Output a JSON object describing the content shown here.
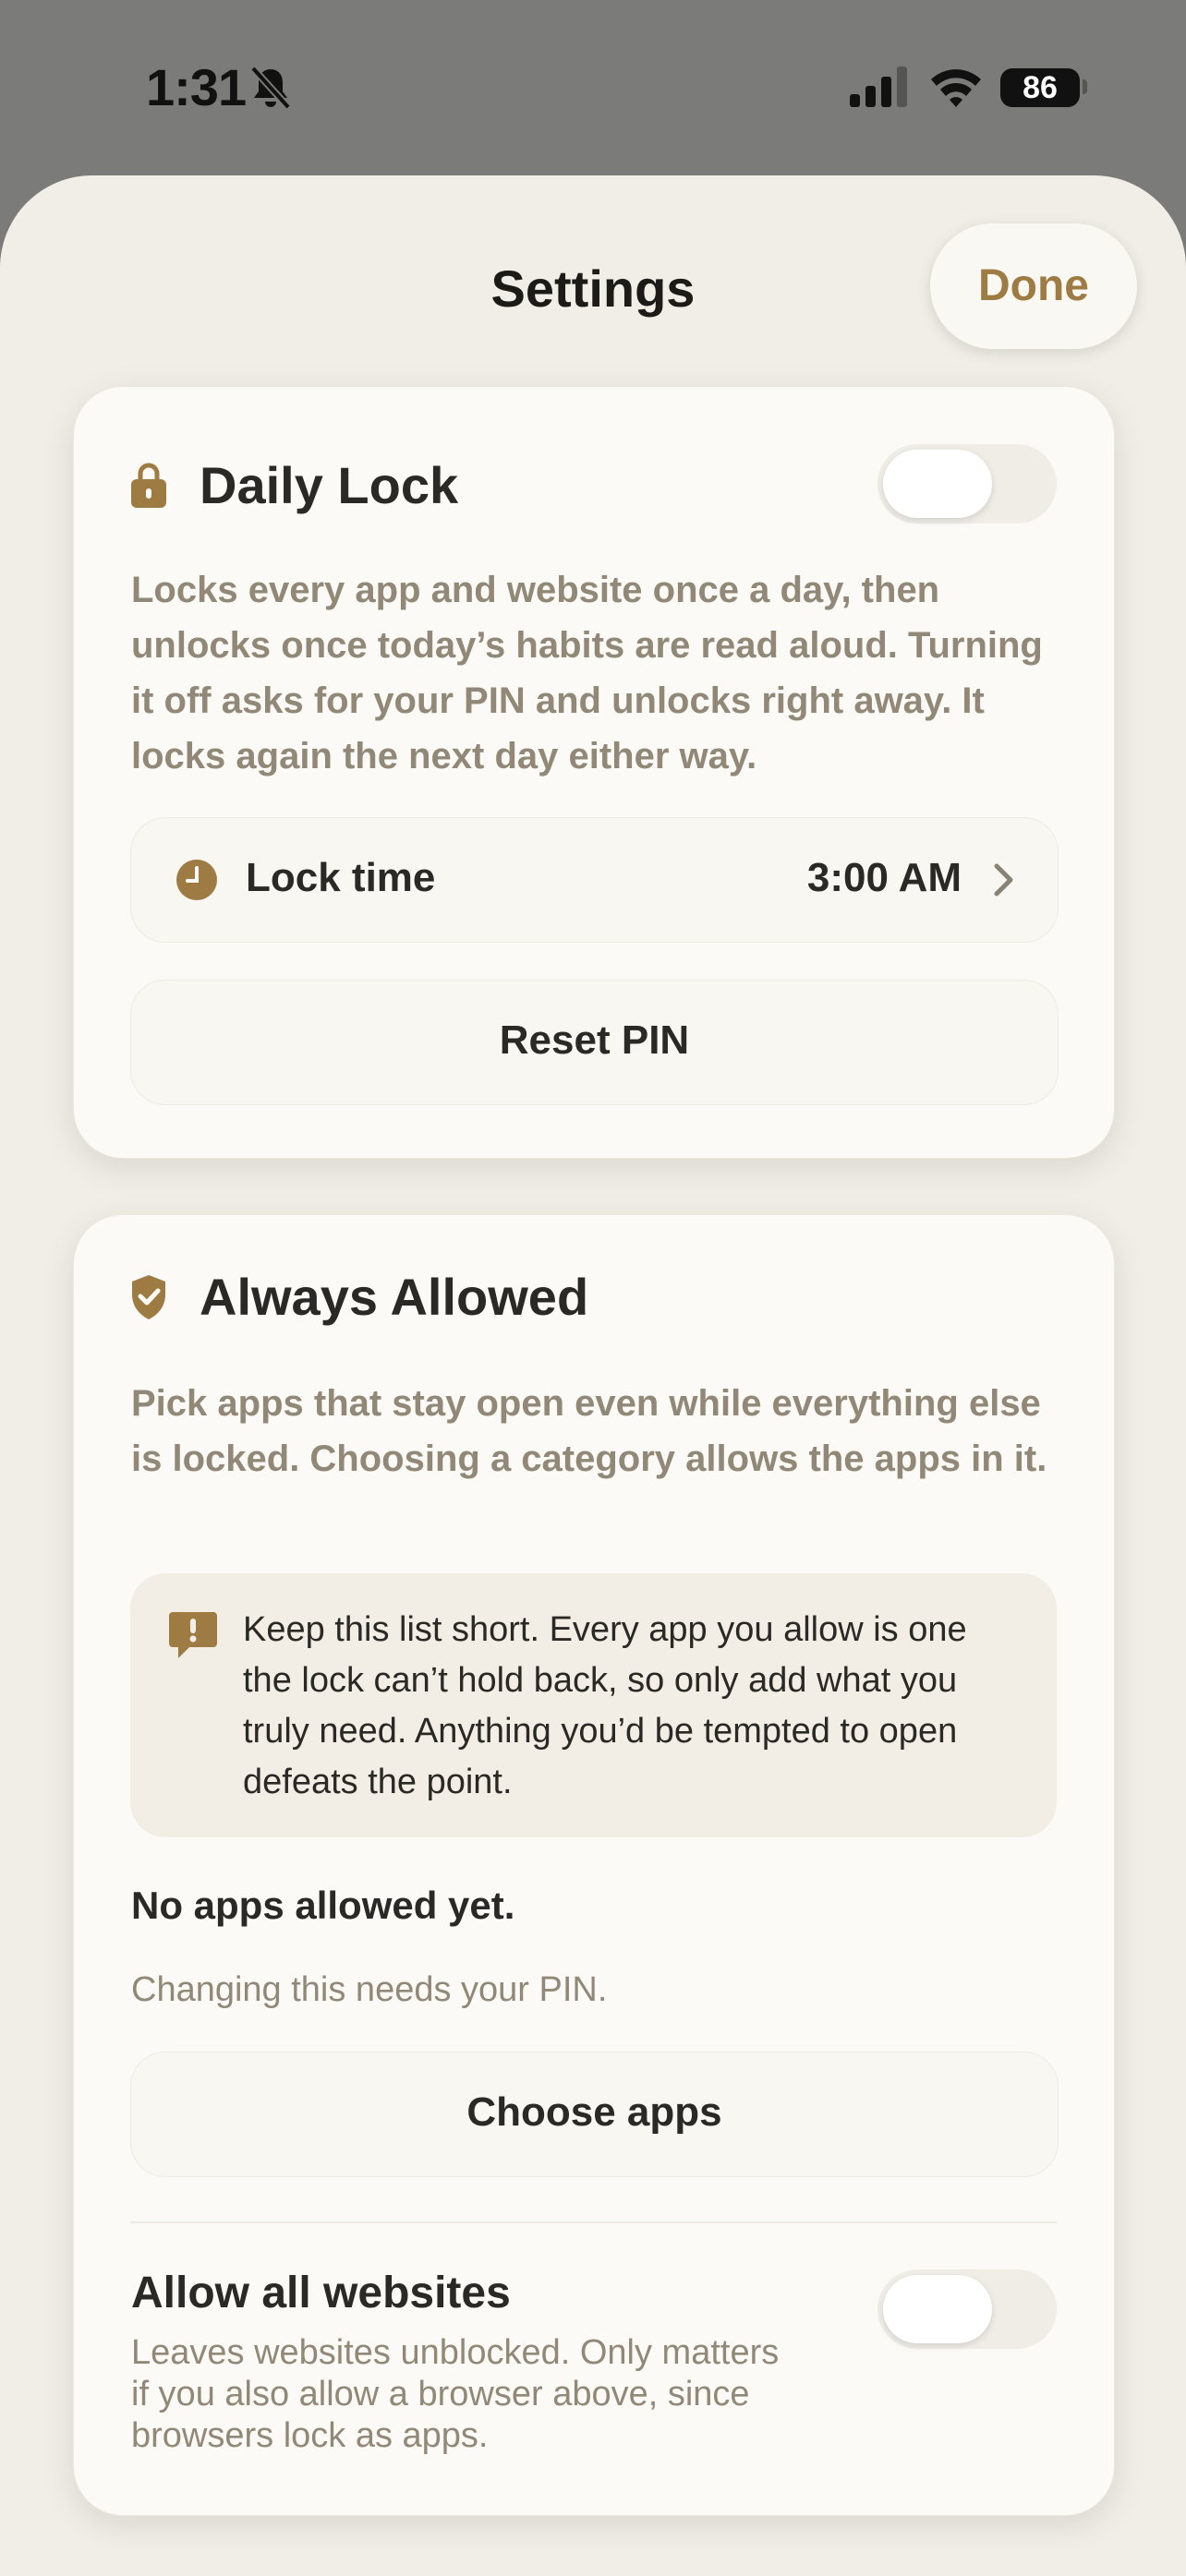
{
  "status": {
    "time": "1:31",
    "battery": "86"
  },
  "header": {
    "title": "Settings",
    "done_label": "Done"
  },
  "daily_lock": {
    "title": "Daily Lock",
    "enabled": false,
    "description": "Locks every app and website once a day, then unlocks once today’s habits are read aloud. Turning it off asks for your PIN and unlocks right away. It locks again the next day either way.",
    "lock_time_label": "Lock time",
    "lock_time_value": "3:00 AM",
    "reset_pin_label": "Reset PIN"
  },
  "always_allowed": {
    "title": "Always Allowed",
    "description": "Pick apps that stay open even while everything else is locked. Choosing a category allows the apps in it.",
    "warning": "Keep this list short. Every app you allow is one the lock can’t hold back, so only add what you truly need. Anything you’d be tempted to open defeats the point.",
    "empty_state": "No apps allowed yet.",
    "pin_note": "Changing this needs your PIN.",
    "choose_apps_label": "Choose apps",
    "allow_websites_title": "Allow all websites",
    "allow_websites_enabled": false,
    "allow_websites_description": "Leaves websites unblocked. Only matters if you also allow a browser above, since browsers lock as apps."
  },
  "colors": {
    "accent": "#9f7b44",
    "sheet_bg": "#f1eee7",
    "card_bg": "#fbfaf6",
    "muted_text": "#928877"
  },
  "icons": [
    "bell-slash-icon",
    "cellular-signal-icon",
    "wifi-icon",
    "lock-icon",
    "clock-icon",
    "chevron-right-icon",
    "shield-check-icon",
    "exclamation-bubble-icon"
  ]
}
